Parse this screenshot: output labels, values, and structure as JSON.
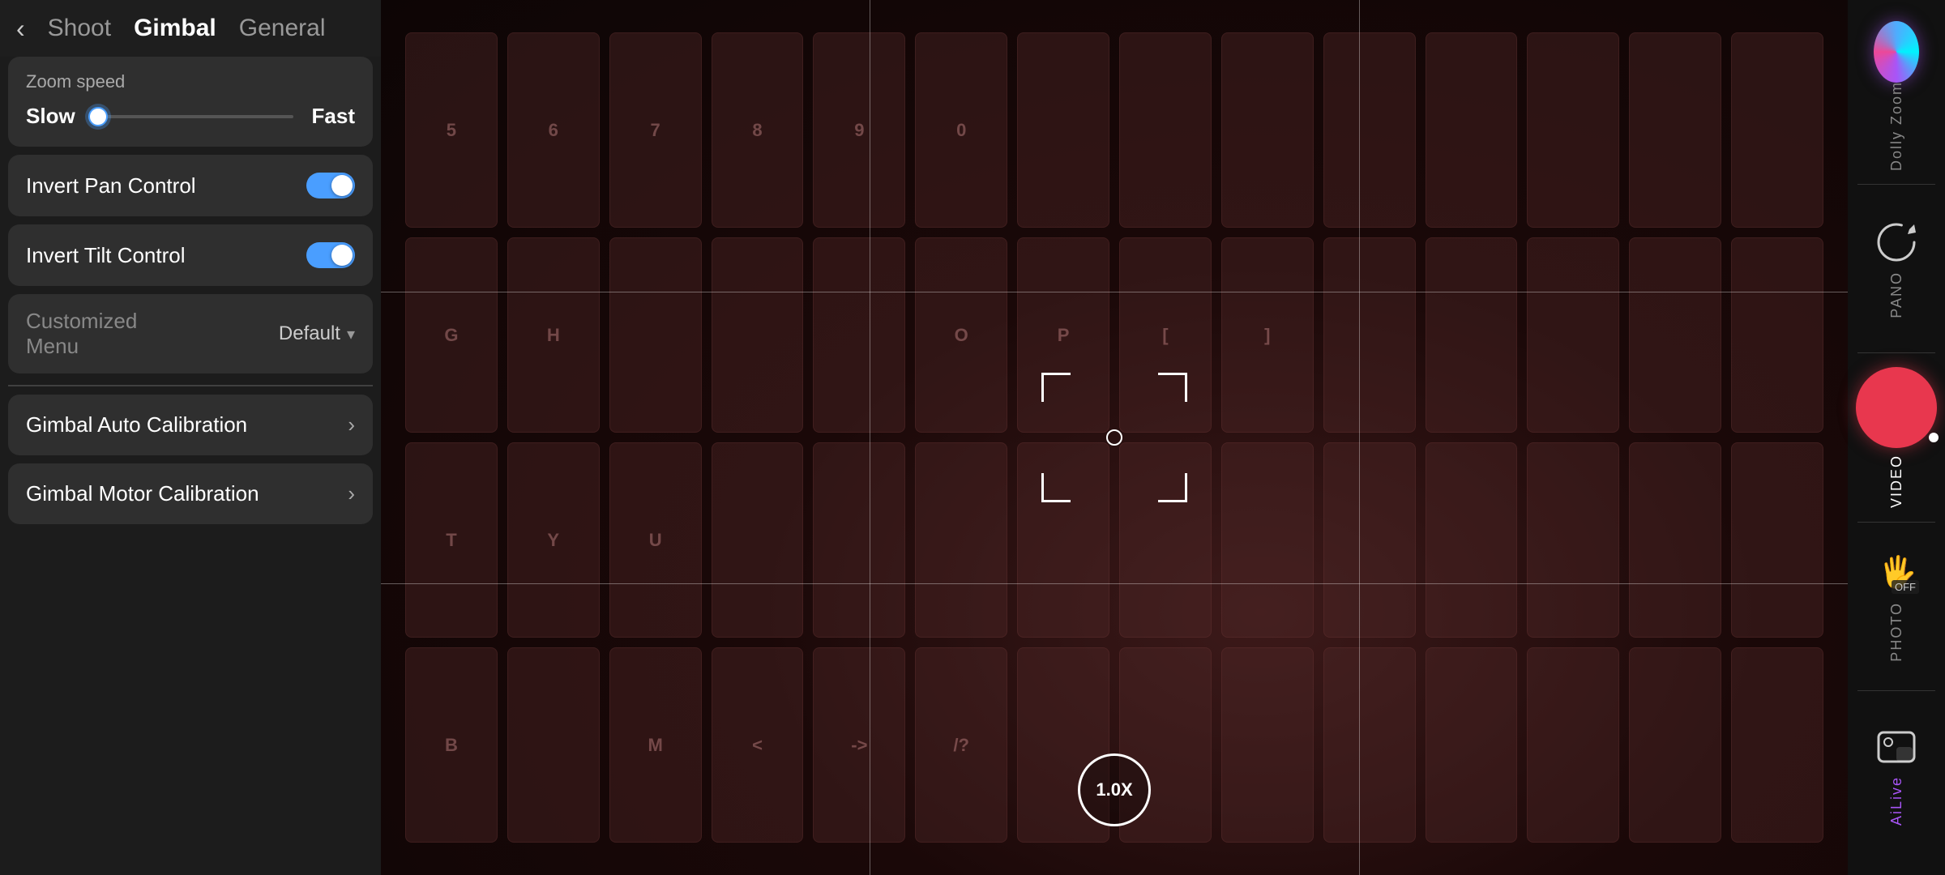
{
  "nav": {
    "back_label": "‹",
    "shoot_label": "Shoot",
    "gimbal_label": "Gimbal",
    "general_label": "General"
  },
  "zoom_speed": {
    "section_label": "Zoom speed",
    "slow_label": "Slow",
    "fast_label": "Fast",
    "value_percent": 5
  },
  "invert_pan": {
    "label": "Invert Pan Control",
    "enabled": true
  },
  "invert_tilt": {
    "label": "Invert Tilt Control",
    "enabled": true
  },
  "customized_menu": {
    "label": "Customized\nMenu",
    "value": "Default"
  },
  "gimbal_auto_calibration": {
    "label": "Gimbal Auto Calibration"
  },
  "gimbal_motor_calibration": {
    "label": "Gimbal Motor Calibration"
  },
  "zoom_display": {
    "value": "1.0X"
  },
  "right_modes": [
    {
      "id": "dolly-zoom",
      "label": "Dolly Zoom",
      "icon": "sphere",
      "active": false
    },
    {
      "id": "pano",
      "label": "PANO",
      "icon": "refresh",
      "active": false
    },
    {
      "id": "video",
      "label": "VIDEO",
      "icon": "record",
      "active": true
    },
    {
      "id": "photo",
      "label": "PHOTO",
      "icon": "gesture",
      "active": false
    },
    {
      "id": "ailive",
      "label": "AiLive",
      "icon": "gallery",
      "active": false
    }
  ]
}
